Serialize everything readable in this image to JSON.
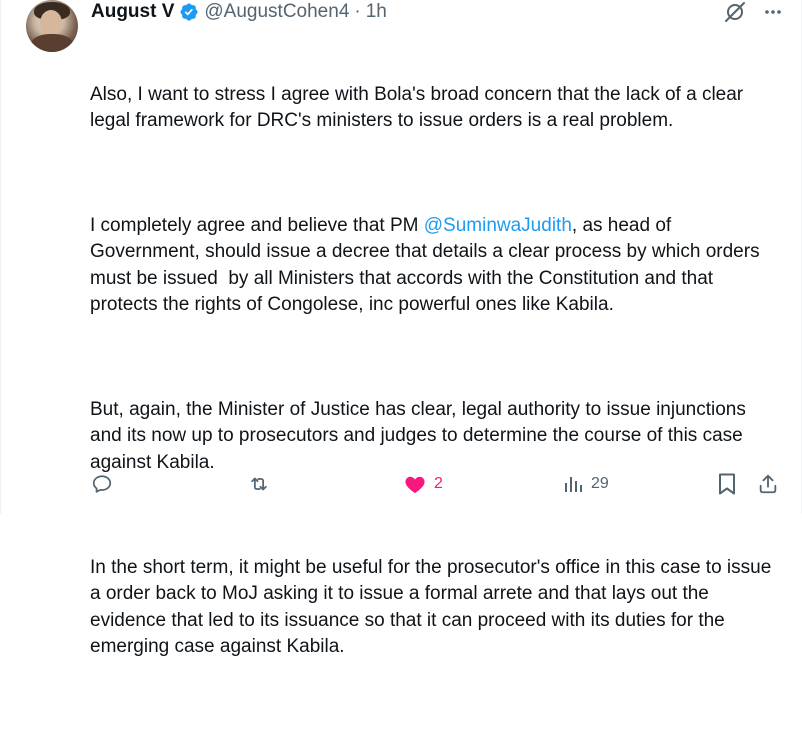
{
  "author": {
    "name": "August V",
    "handle": "@AugustCohen4",
    "separator": "·",
    "time": "1h"
  },
  "body": {
    "p1": "Also, I want to stress I agree with Bola's broad concern that the lack of a clear legal framework for DRC's ministers to issue orders is a real problem.",
    "p2_before": "I completely agree and believe that PM ",
    "p2_mention": "@SuminwaJudith",
    "p2_after": ", as head of Government, should issue a decree that details a clear process by which orders must be issued  by all Ministers that accords with the Constitution and that protects the rights of Congolese, inc powerful ones like Kabila.",
    "p3": "But, again, the Minister of Justice has clear, legal authority to issue injunctions and its now up to prosecutors and judges to determine the course of this case against Kabila.",
    "p4": "In the short term, it might be useful for the prosecutor's office in this case to issue a order back to MoJ asking it to issue a formal arrete and that lays out the evidence that led to its issuance so that it can proceed with its duties for the emerging case against Kabila."
  },
  "actions": {
    "likes": "2",
    "views": "29"
  },
  "icons": {
    "verified": "verified-badge-icon",
    "grok": "grok-icon",
    "more": "more-icon",
    "reply": "reply-icon",
    "repost": "repost-icon",
    "like": "heart-filled-icon",
    "views": "views-icon",
    "bookmark": "bookmark-icon",
    "share": "share-icon"
  },
  "colors": {
    "accent": "#1d9bf0",
    "like": "#f91880",
    "secondary_text": "#536471",
    "text": "#0f1419"
  }
}
